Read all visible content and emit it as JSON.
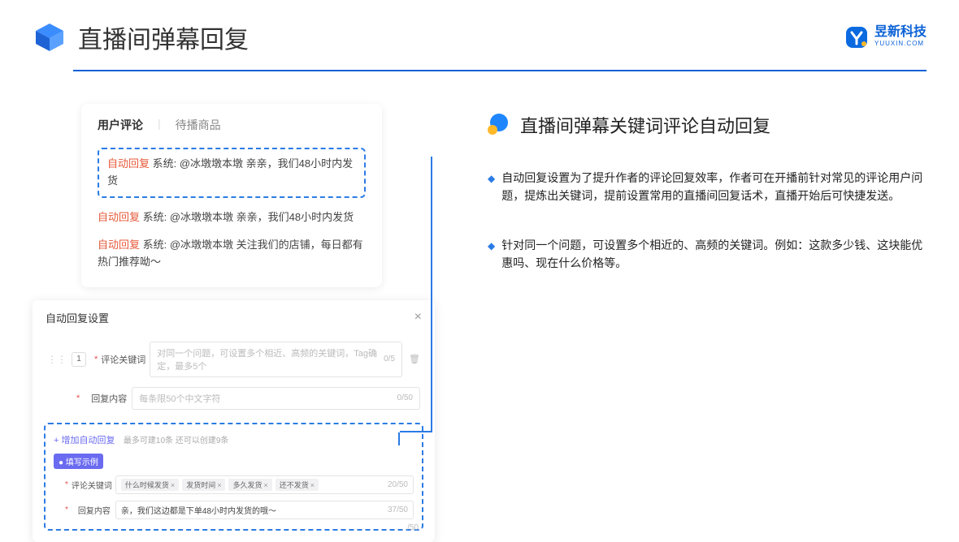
{
  "header": {
    "title": "直播间弹幕回复",
    "brand_cn": "昱新科技",
    "brand_en": "YUUXIN.COM"
  },
  "comments": {
    "tab_user": "用户评论",
    "tab_goods": "待播商品",
    "auto_reply_label": "自动回复",
    "row1": " 系统: @冰墩墩本墩 亲亲，我们48小时内发货",
    "row2": " 系统: @冰墩墩本墩 亲亲，我们48小时内发货",
    "row3": " 系统: @冰墩墩本墩 关注我们的店铺，每日都有热门推荐呦～"
  },
  "settings": {
    "title": "自动回复设置",
    "num": "1",
    "keyword_label": "评论关键词",
    "keyword_placeholder": "对同一个问题，可设置多个相近、高频的关键词，Tag确定，最多5个",
    "keyword_counter": "0/5",
    "content_label": "回复内容",
    "content_placeholder": "每条限50个中文字符",
    "content_counter": "0/50",
    "trash_glyph": "🗑",
    "add_link": "+ 增加自动回复",
    "add_sub": "最多可建10条 还可以创建9条",
    "example_badge": "● 填写示例",
    "ex_keyword_label": "评论关键词",
    "ex_tags": [
      "什么时候发货",
      "发货时间",
      "多久发货",
      "还不发货"
    ],
    "ex_keyword_counter": "20/50",
    "ex_content_label": "回复内容",
    "ex_content_value": "亲，我们这边都是下单48小时内发货的哦～",
    "ex_content_counter": "37/50",
    "outside_counter": "/50"
  },
  "right": {
    "title": "直播间弹幕关键词评论自动回复",
    "bullet1": "自动回复设置为了提升作者的评论回复效率，作者可在开播前针对常见的评论用户问题，提炼出关键词，提前设置常用的直播间回复话术，直播开始后可快捷发送。",
    "bullet2": "针对同一个问题，可设置多个相近的、高频的关键词。例如：这款多少钱、这块能优惠吗、现在什么价格等。"
  }
}
